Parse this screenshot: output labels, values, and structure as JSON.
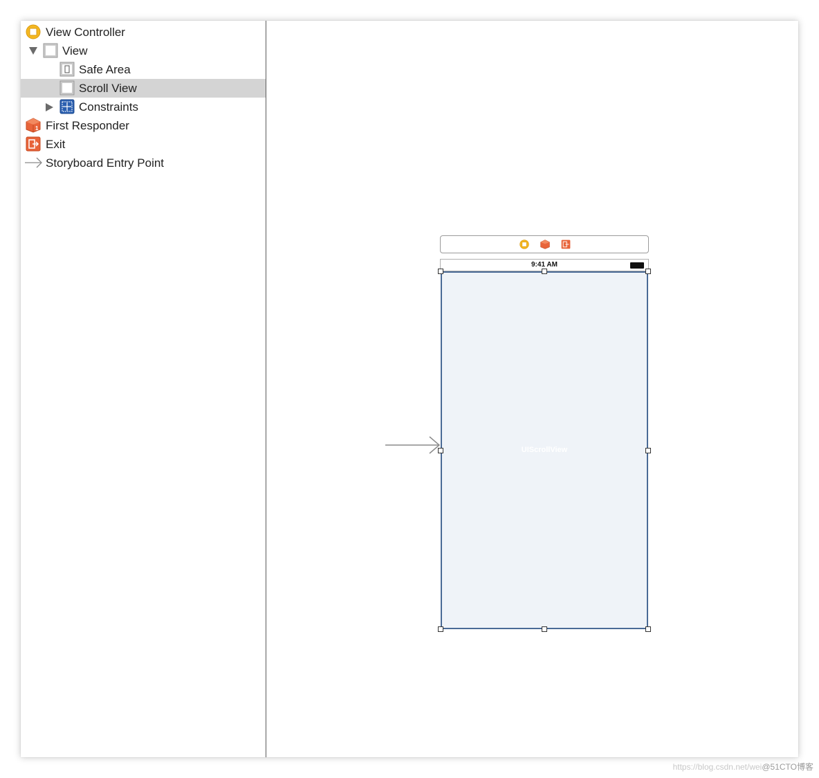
{
  "outline": {
    "items": [
      {
        "label": "View Controller",
        "icon": "view-controller-icon"
      },
      {
        "label": "View",
        "icon": "view-icon",
        "expanded": true
      },
      {
        "label": "Safe Area",
        "icon": "safe-area-icon"
      },
      {
        "label": "Scroll View",
        "icon": "scroll-view-icon",
        "selected": true
      },
      {
        "label": "Constraints",
        "icon": "constraints-icon",
        "expanded": false
      },
      {
        "label": "First Responder",
        "icon": "first-responder-icon"
      },
      {
        "label": "Exit",
        "icon": "exit-icon"
      },
      {
        "label": "Storyboard Entry Point",
        "icon": "entry-point-icon"
      }
    ]
  },
  "scene": {
    "status_time": "9:41 AM",
    "scroll_view_label": "UIScrollView"
  },
  "watermark": {
    "url": "https://blog.csdn.net/wei",
    "brand": "@51CTO博客"
  },
  "colors": {
    "selection": "#d4d4d4",
    "scroll_view_fill": "#eff3f8",
    "scroll_view_border": "#4a6a96",
    "view_controller_icon": "#f5b822",
    "responder_icon": "#e8643a",
    "constraints_icon": "#2a5fb0"
  }
}
